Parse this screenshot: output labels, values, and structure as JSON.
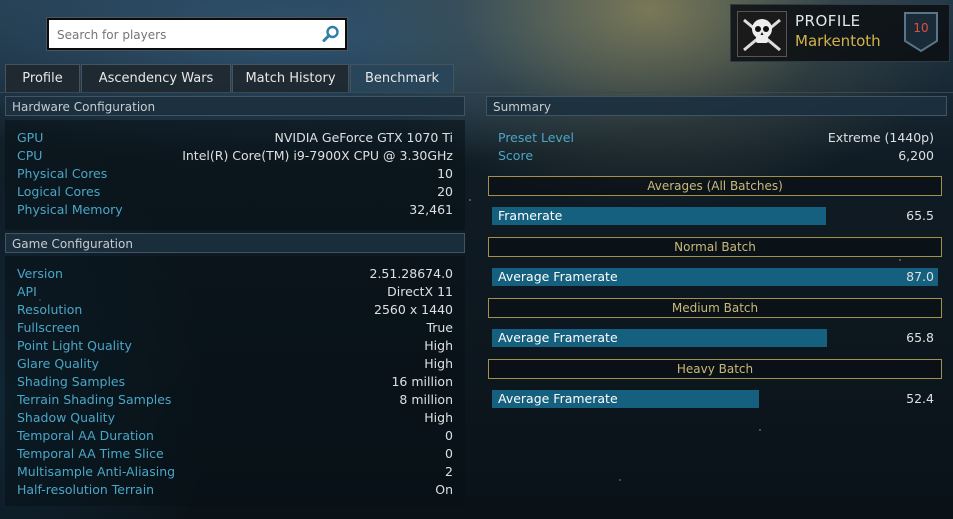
{
  "search": {
    "placeholder": "Search for players"
  },
  "profile": {
    "title": "PROFILE",
    "name": "Markentoth",
    "level": "10"
  },
  "tabs": [
    {
      "label": "Profile"
    },
    {
      "label": "Ascendency Wars"
    },
    {
      "label": "Match History"
    },
    {
      "label": "Benchmark"
    }
  ],
  "hardware": {
    "title": "Hardware Configuration",
    "rows": [
      {
        "label": "GPU",
        "value": "NVIDIA GeForce GTX 1070 Ti"
      },
      {
        "label": "CPU",
        "value": "Intel(R) Core(TM) i9-7900X CPU @ 3.30GHz"
      },
      {
        "label": "Physical Cores",
        "value": "10"
      },
      {
        "label": "Logical Cores",
        "value": "20"
      },
      {
        "label": "Physical Memory",
        "value": "32,461"
      }
    ]
  },
  "game": {
    "title": "Game Configuration",
    "rows": [
      {
        "label": "Version",
        "value": "2.51.28674.0"
      },
      {
        "label": "API",
        "value": "DirectX 11"
      },
      {
        "label": "Resolution",
        "value": "2560 x 1440"
      },
      {
        "label": "Fullscreen",
        "value": "True"
      },
      {
        "label": "Point Light Quality",
        "value": "High"
      },
      {
        "label": "Glare Quality",
        "value": "High"
      },
      {
        "label": "Shading Samples",
        "value": "16 million"
      },
      {
        "label": "Terrain Shading Samples",
        "value": "8 million"
      },
      {
        "label": "Shadow Quality",
        "value": "High"
      },
      {
        "label": "Temporal AA Duration",
        "value": "0"
      },
      {
        "label": "Temporal AA Time Slice",
        "value": "0"
      },
      {
        "label": "Multisample Anti-Aliasing",
        "value": "2"
      },
      {
        "label": "Half-resolution Terrain",
        "value": "On"
      }
    ]
  },
  "summary": {
    "title": "Summary",
    "preset_label": "Preset Level",
    "preset_value": "Extreme (1440p)",
    "score_label": "Score",
    "score_value": "6,200",
    "batches": [
      {
        "title": "Averages (All Batches)",
        "bar_label": "Framerate",
        "value": "65.5",
        "fill": 0.749
      },
      {
        "title": "Normal Batch",
        "bar_label": "Average Framerate",
        "value": "87.0",
        "fill": 1.0
      },
      {
        "title": "Medium Batch",
        "bar_label": "Average Framerate",
        "value": "65.8",
        "fill": 0.752
      },
      {
        "title": "Heavy Batch",
        "bar_label": "Average Framerate",
        "value": "52.4",
        "fill": 0.599
      }
    ]
  }
}
